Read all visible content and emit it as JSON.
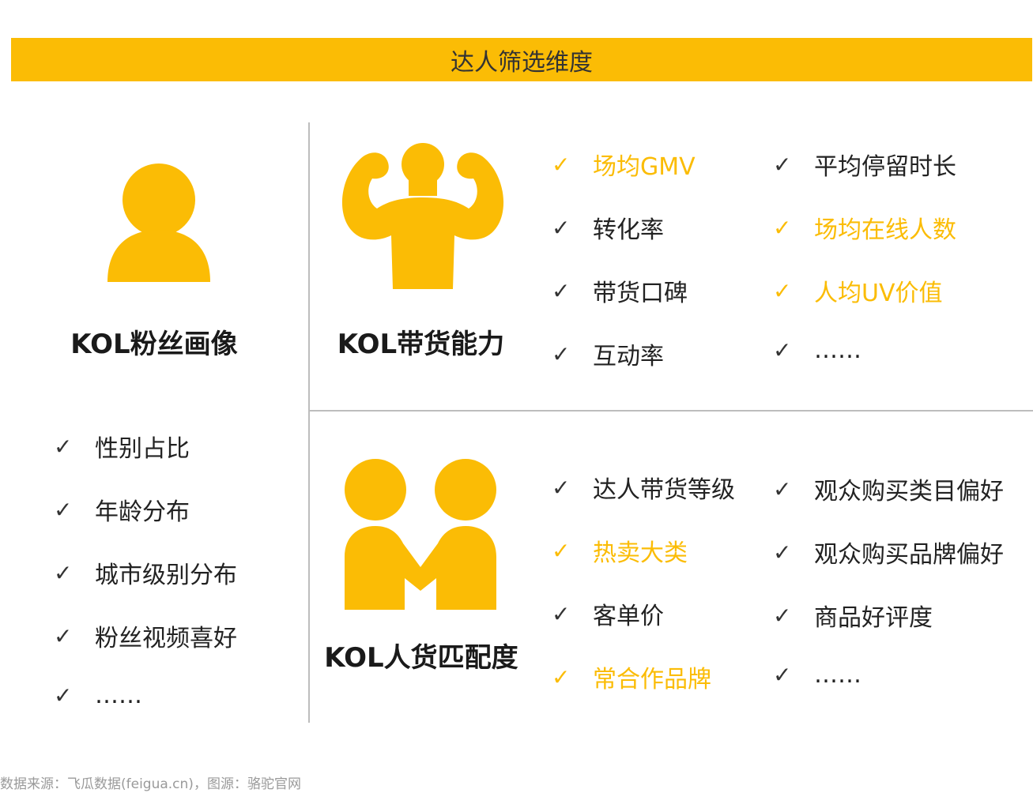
{
  "banner": {
    "title": "达人筛选维度"
  },
  "colors": {
    "accent": "#FBBC05",
    "text": "#333333",
    "divider": "#bdbdbd"
  },
  "check_symbol": "✓",
  "fans": {
    "icon": "person-icon",
    "title": "KOL粉丝画像",
    "items": [
      "性别占比",
      "年龄分布",
      "城市级别分布",
      "粉丝视频喜好",
      "……"
    ]
  },
  "ability": {
    "icon": "muscle-man-icon",
    "title": "KOL带货能力",
    "left": [
      {
        "label": "场均GMV",
        "highlighted": true
      },
      {
        "label": "转化率",
        "highlighted": false
      },
      {
        "label": "带货口碑",
        "highlighted": false
      },
      {
        "label": "互动率",
        "highlighted": false
      }
    ],
    "right": [
      {
        "label": "平均停留时长",
        "highlighted": false
      },
      {
        "label": "场均在线人数",
        "highlighted": true
      },
      {
        "label": "人均UV价值",
        "highlighted": true
      },
      {
        "label": "……",
        "highlighted": false
      }
    ]
  },
  "match": {
    "icon": "handshake-people-icon",
    "title": "KOL人货匹配度",
    "left": [
      {
        "label": "达人带货等级",
        "highlighted": false
      },
      {
        "label": "热卖大类",
        "highlighted": true
      },
      {
        "label": "客单价",
        "highlighted": false
      },
      {
        "label": "常合作品牌",
        "highlighted": true
      }
    ],
    "right": [
      {
        "label": "观众购买类目偏好",
        "highlighted": false
      },
      {
        "label": "观众购买品牌偏好",
        "highlighted": false
      },
      {
        "label": "商品好评度",
        "highlighted": false
      },
      {
        "label": "……",
        "highlighted": false
      }
    ]
  },
  "footer": {
    "source": "数据来源：飞瓜数据(feigua.cn)，图源：骆驼官网"
  }
}
